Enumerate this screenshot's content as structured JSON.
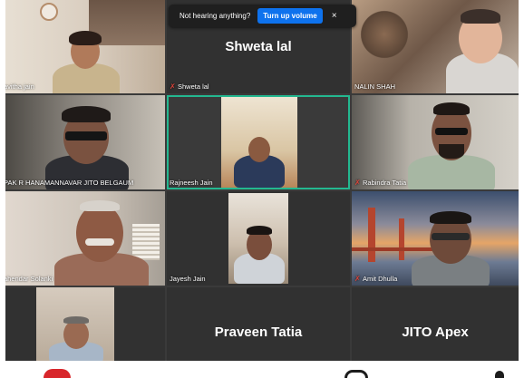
{
  "notification": {
    "message": "Not hearing anything?",
    "button_label": "Turn up volume",
    "close_glyph": "×"
  },
  "participants": [
    {
      "name": "avitha jain",
      "muted": false
    },
    {
      "name": "Shweta lal",
      "muted": true,
      "display_name": "Shweta lal"
    },
    {
      "name": "NALIN SHAH",
      "muted": false
    },
    {
      "name": "PAK R HANAMANNAVAR JITO BELGAUM",
      "muted": false
    },
    {
      "name": "Rajneesh Jain",
      "muted": false,
      "active_speaker": true
    },
    {
      "name": "Rabindra Tatia",
      "muted": true
    },
    {
      "name": "ahendar Solanki",
      "muted": false
    },
    {
      "name": "Jayesh Jain",
      "muted": false
    },
    {
      "name": "Amit Dhulla",
      "muted": true
    },
    {
      "name": "",
      "muted": false
    },
    {
      "name": "",
      "muted": false,
      "display_name": "Praveen Tatia"
    },
    {
      "name": "",
      "muted": false,
      "display_name": "JITO Apex"
    }
  ],
  "colors": {
    "active_border": "#23b890",
    "muted_icon": "#e0453a",
    "button": "#0e72ed",
    "tile_bg": "#313131"
  }
}
